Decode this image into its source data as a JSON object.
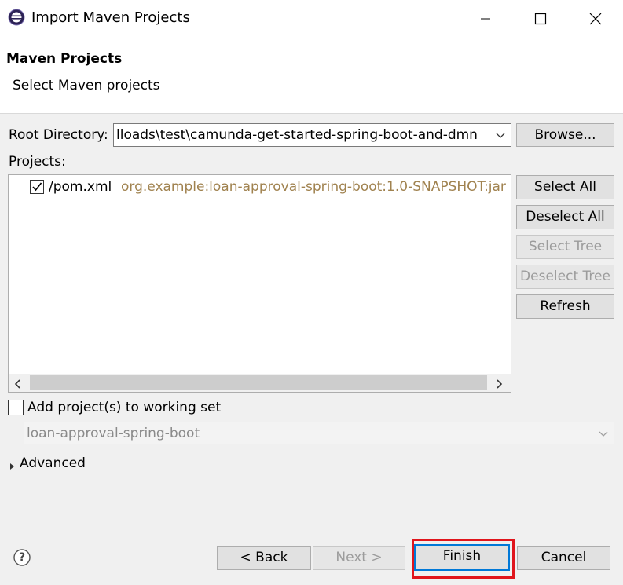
{
  "window": {
    "title": "Import Maven Projects",
    "minimize_glyph": "—",
    "maximize_glyph": "☐",
    "close_glyph": "✕"
  },
  "header": {
    "title": "Maven Projects",
    "subtitle": "Select Maven projects"
  },
  "root_directory": {
    "label": "Root Directory:",
    "value": "lloads\\test\\camunda-get-started-spring-boot-and-dmn",
    "browse_label": "Browse..."
  },
  "projects": {
    "label": "Projects:",
    "items": [
      {
        "checked": true,
        "path": "/pom.xml",
        "artifact": "org.example:loan-approval-spring-boot:1.0-SNAPSHOT:jar"
      }
    ]
  },
  "side_buttons": {
    "select_all": "Select All",
    "deselect_all": "Deselect All",
    "select_tree": "Select Tree",
    "deselect_tree": "Deselect Tree",
    "refresh": "Refresh"
  },
  "working_set": {
    "checked": false,
    "label": "Add project(s) to working set",
    "value": "loan-approval-spring-boot"
  },
  "advanced": {
    "label": "Advanced",
    "expanded": false
  },
  "footer": {
    "help_glyph": "?",
    "back_label": "< Back",
    "next_label": "Next >",
    "finish_label": "Finish",
    "cancel_label": "Cancel"
  },
  "colors": {
    "artifact_text": "#a0824f",
    "highlight_border": "#e0151c",
    "default_button_border": "#0078d7"
  }
}
